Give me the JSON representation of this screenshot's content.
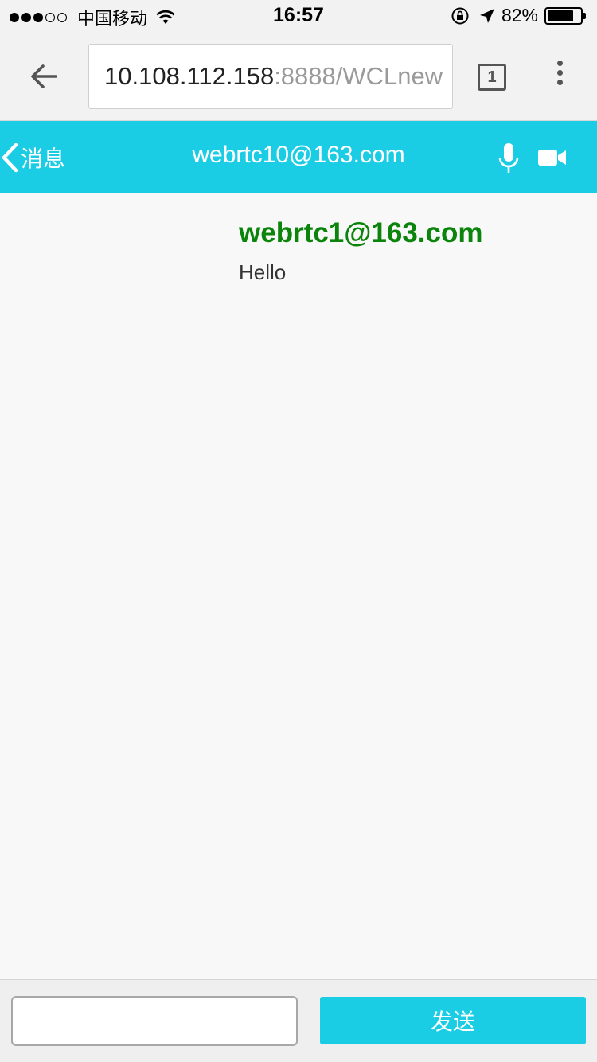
{
  "status_bar": {
    "carrier": "中国移动",
    "time": "16:57",
    "battery_percent": "82%",
    "battery_level": 0.82,
    "signal_bars_filled": 3,
    "signal_bars_total": 5
  },
  "browser": {
    "url_host": "10.108.112.158",
    "url_rest": ":8888/WCLnew",
    "tab_count": "1"
  },
  "header": {
    "back_label": "消息",
    "title": "webrtc10@163.com"
  },
  "messages": [
    {
      "sender": "webrtc1@163.com",
      "text": "Hello"
    }
  ],
  "composer": {
    "input_value": "",
    "send_label": "发送"
  },
  "colors": {
    "accent": "#1bcce5",
    "sender_name": "#0a840a"
  }
}
